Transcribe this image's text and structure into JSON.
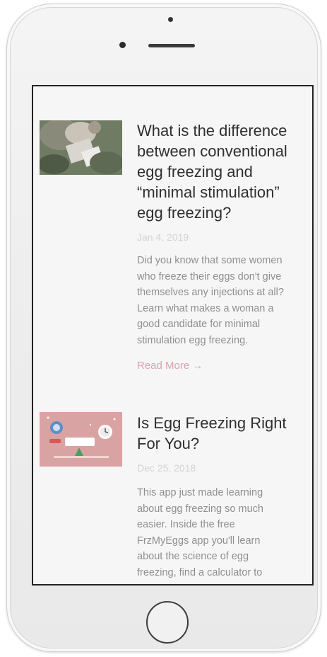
{
  "posts": [
    {
      "title": "What is the difference\nbetween conventional\negg freezing and\n“minimal stimulation”\negg freezing?",
      "date": "Jan 4, 2019",
      "excerpt": "Did you know that some women\nwho freeze their eggs don't give\nthemselves any injections at all?\nLearn what makes a woman a\ngood candidate for minimal\nstimulation egg freezing.",
      "read_more": "Read More →"
    },
    {
      "title": "Is Egg Freezing Right\nFor You?",
      "date": "Dec 25, 2018",
      "excerpt": "This app just made learning\nabout egg freezing so much\neasier. Inside the free\nFrzMyEggs app you'll learn\nabout the science of egg\nfreezing, find a calculator to"
    }
  ],
  "colors": {
    "title": "#2f2f2f",
    "date": "#d3d3d3",
    "excerpt": "#8f8f8f",
    "read_more": "#d9a2b0",
    "thumb2_bg": "#d9a3a3"
  }
}
